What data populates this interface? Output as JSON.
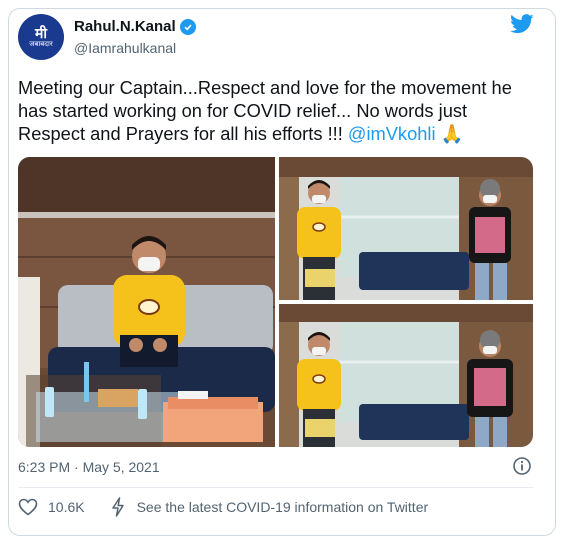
{
  "author": {
    "name": "Rahul.N.Kanal",
    "handle": "@Iamrahulkanal",
    "avatar_mark": "मी",
    "avatar_sub": "जबाबदार"
  },
  "tweet": {
    "text": "Meeting our Captain...Respect and love for the movement he has started working on for COVID relief... No words just Respect and Prayers for all his efforts !!! ",
    "mention": "@imVkohli",
    "emoji": "🙏"
  },
  "footer": {
    "timestamp": "6:23 PM · May 5, 2021",
    "likes": "10.6K",
    "covid_link": "See the latest COVID-19 information on Twitter"
  },
  "colors": {
    "accent": "#1d9bf0",
    "text": "#0f1419",
    "muted": "#536471",
    "shirt": "#f4c21a"
  },
  "icons": [
    "verified-badge-icon",
    "twitter-bird-icon",
    "info-icon",
    "heart-icon",
    "lightning-icon"
  ]
}
